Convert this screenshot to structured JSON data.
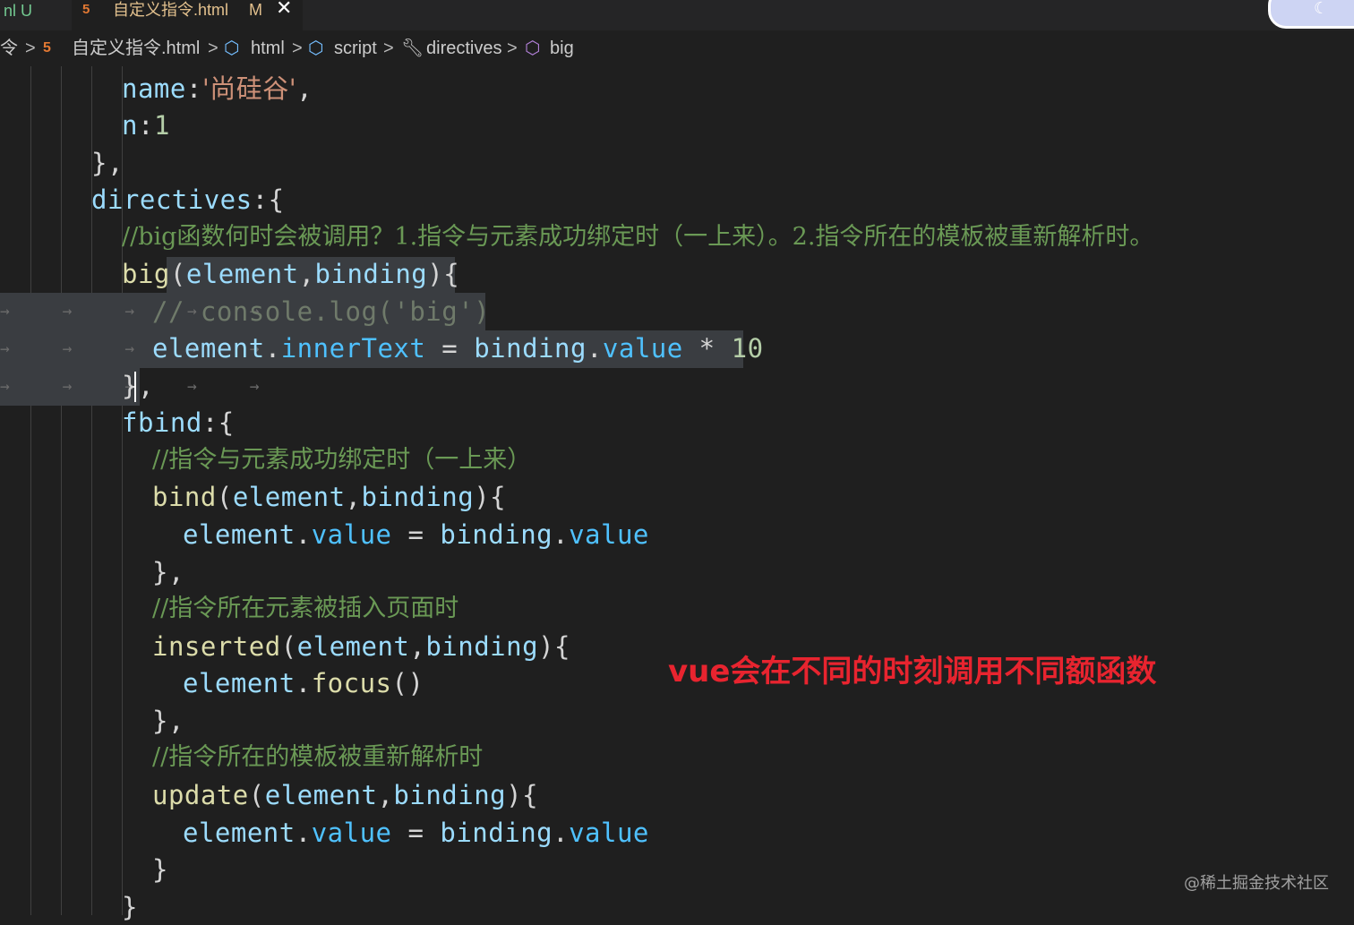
{
  "tabs": {
    "previous": "nl U",
    "active": {
      "icon": "html5-icon",
      "label": "自定义指令.html",
      "modified": "M",
      "close": "✕"
    }
  },
  "breadcrumb": {
    "items": [
      "令",
      "自定义指令.html",
      "html",
      "script",
      "directives",
      "big"
    ],
    "separator": ">"
  },
  "code": {
    "l1": [
      "name",
      ":",
      "'尚硅谷'",
      ","
    ],
    "l2": [
      "n",
      ":",
      "1"
    ],
    "l3": "},",
    "l4": [
      "directives",
      ":{"
    ],
    "l5": "//big函数何时会被调用？1.指令与元素成功绑定时（一上来）。2.指令所在的模板被重新解析时。",
    "l6": [
      "big",
      "(",
      "element",
      ",",
      "binding",
      "){"
    ],
    "l7": "// console.log('big')",
    "l8": [
      "element",
      ".",
      "innerText",
      " = ",
      "binding",
      ".",
      "value",
      " * ",
      "10"
    ],
    "l9": "},",
    "l10": [
      "fbind",
      ":{"
    ],
    "l11": "//指令与元素成功绑定时（一上来）",
    "l12": [
      "bind",
      "(",
      "element",
      ",",
      "binding",
      "){"
    ],
    "l13": [
      "element",
      ".",
      "value",
      " = ",
      "binding",
      ".",
      "value"
    ],
    "l14": "},",
    "l15": "//指令所在元素被插入页面时",
    "l16": [
      "inserted",
      "(",
      "element",
      ",",
      "binding",
      "){"
    ],
    "l17": [
      "element",
      ".",
      "focus",
      "()"
    ],
    "l18": "},",
    "l19": "//指令所在的模板被重新解析时",
    "l20": [
      "update",
      "(",
      "element",
      ",",
      "binding",
      "){"
    ],
    "l21": [
      "element",
      ".",
      "value",
      " = ",
      "binding",
      ".",
      "value"
    ],
    "l22": "}",
    "l23": "}"
  },
  "whitespace_arrows": "→ → → → →",
  "annotation": "vue会在不同的时刻调用不同额函数",
  "watermark": "@稀土掘金技术社区",
  "colors": {
    "annotation": "#e8242f",
    "keyword_blue": "#569cd6",
    "function_yellow": "#dcdcaa",
    "variable_lightblue": "#9cdcfe",
    "comment": "#6a9955"
  }
}
